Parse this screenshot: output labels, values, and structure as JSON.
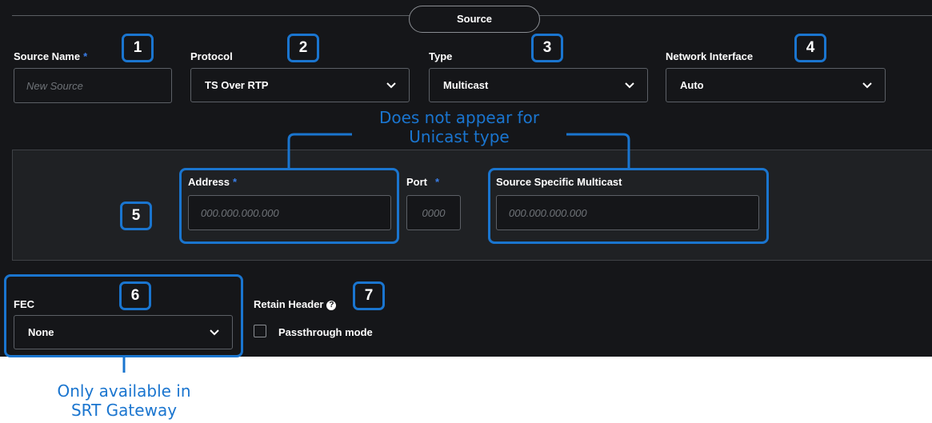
{
  "section": {
    "title": "Source"
  },
  "fields": {
    "source_name": {
      "label": "Source Name",
      "required_mark": "*",
      "placeholder": "New Source"
    },
    "protocol": {
      "label": "Protocol",
      "value": "TS Over RTP"
    },
    "type": {
      "label": "Type",
      "value": "Multicast"
    },
    "network_interface": {
      "label": "Network Interface",
      "value": "Auto"
    },
    "address": {
      "label": "Address",
      "required_mark": "*",
      "placeholder": "000.000.000.000"
    },
    "port": {
      "label": "Port",
      "required_mark": "*",
      "placeholder": "0000"
    },
    "ssm": {
      "label": "Source Specific Multicast",
      "placeholder": "000.000.000.000"
    },
    "fec": {
      "label": "FEC",
      "value": "None"
    },
    "retain_header": {
      "label": "Retain Header",
      "checkbox_label": "Passthrough mode",
      "checked": false,
      "help_icon": "question-circle-icon"
    }
  },
  "callouts": [
    "1",
    "2",
    "3",
    "4",
    "5",
    "6",
    "7"
  ],
  "annotations": {
    "not_unicast": [
      "Does not appear for",
      "Unicast type"
    ],
    "srt_only": [
      "Only available in",
      "SRT Gateway"
    ]
  },
  "colors": {
    "panel_bg": "#151619",
    "subpanel_bg": "#1f2124",
    "annotation": "#1a75cf",
    "required": "#3a7ee8"
  }
}
